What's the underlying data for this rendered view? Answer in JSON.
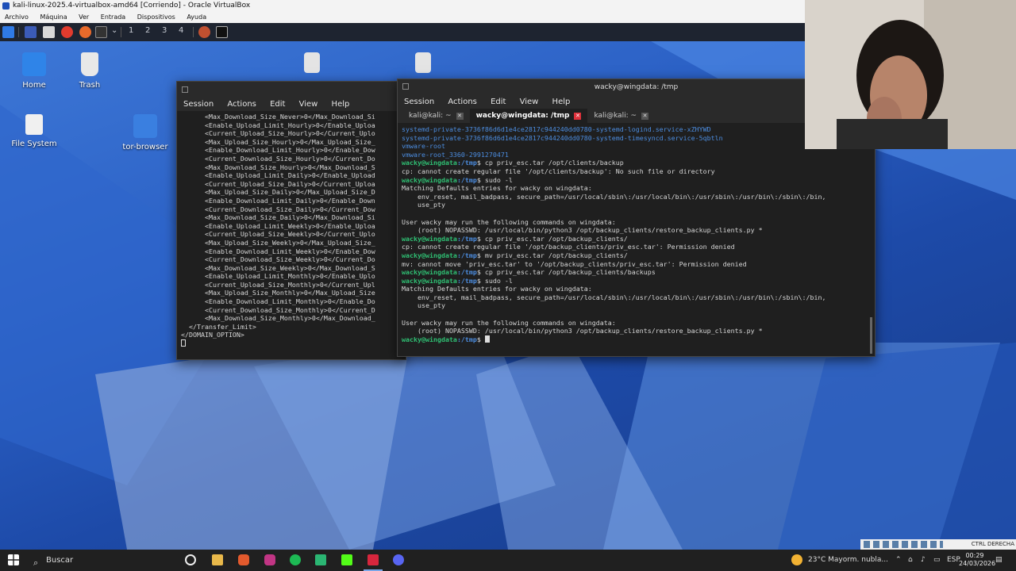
{
  "host": {
    "window_title": "kali-linux-2025.4-virtualbox-amd64 [Corriendo] - Oracle VirtualBox",
    "menu": [
      "Archivo",
      "Máquina",
      "Ver",
      "Entrada",
      "Dispositivos",
      "Ayuda"
    ]
  },
  "kali_panel": {
    "workspaces": [
      "1",
      "2",
      "3",
      "4"
    ]
  },
  "desktop_icons": [
    {
      "label": "Home"
    },
    {
      "label": "Trash"
    },
    {
      "label": "File System"
    },
    {
      "label": "tor-browser"
    }
  ],
  "term_left": {
    "menu": [
      "Session",
      "Actions",
      "Edit",
      "View",
      "Help"
    ],
    "lines": [
      "      <Max_Download_Size_Never>0</Max_Download_Si",
      "      <Enable_Upload_Limit_Hourly>0</Enable_Uploa",
      "      <Current_Upload_Size_Hourly>0</Current_Uplo",
      "      <Max_Upload_Size_Hourly>0</Max_Upload_Size_",
      "      <Enable_Download_Limit_Hourly>0</Enable_Dow",
      "      <Current_Download_Size_Hourly>0</Current_Do",
      "      <Max_Download_Size_Hourly>0</Max_Download_S",
      "      <Enable_Upload_Limit_Daily>0</Enable_Upload",
      "      <Current_Upload_Size_Daily>0</Current_Uploa",
      "      <Max_Upload_Size_Daily>0</Max_Upload_Size_D",
      "      <Enable_Download_Limit_Daily>0</Enable_Down",
      "      <Current_Download_Size_Daily>0</Current_Dow",
      "      <Max_Download_Size_Daily>0</Max_Download_Si",
      "      <Enable_Upload_Limit_Weekly>0</Enable_Uploa",
      "      <Current_Upload_Size_Weekly>0</Current_Uplo",
      "      <Max_Upload_Size_Weekly>0</Max_Upload_Size_",
      "      <Enable_Download_Limit_Weekly>0</Enable_Dow",
      "      <Current_Download_Size_Weekly>0</Current_Do",
      "      <Max_Download_Size_Weekly>0</Max_Download_S",
      "      <Enable_Upload_Limit_Monthly>0</Enable_Uplo",
      "      <Current_Upload_Size_Monthly>0</Current_Upl",
      "      <Max_Upload_Size_Monthly>0</Max_Upload_Size",
      "      <Enable_Download_Limit_Monthly>0</Enable_Do",
      "      <Current_Download_Size_Monthly>0</Current_D",
      "      <Max_Download_Size_Monthly>0</Max_Download_",
      "  </Transfer_Limit>",
      "</DOMAIN_OPTION>"
    ]
  },
  "term_right": {
    "title": "wacky@wingdata: /tmp",
    "menu": [
      "Session",
      "Actions",
      "Edit",
      "View",
      "Help"
    ],
    "tabs": [
      {
        "label": "kali@kali: ~",
        "active": false
      },
      {
        "label": "wacky@wingdata: /tmp",
        "active": true
      },
      {
        "label": "kali@kali: ~",
        "active": false
      }
    ],
    "prompt_user": "wacky@wingdata",
    "prompt_path": ":/tmp",
    "prompt_sym": "$",
    "lines": [
      {
        "t": "blue",
        "text": "systemd-private-3736f86d6d1e4ce2817c944240dd0780-systemd-logind.service-xZHYWD"
      },
      {
        "t": "blue",
        "text": "systemd-private-3736f86d6d1e4ce2817c944240dd0780-systemd-timesyncd.service-5qbtln"
      },
      {
        "t": "blue",
        "text": "vmware-root"
      },
      {
        "t": "blue",
        "text": "vmware-root_3360-2991270471"
      },
      {
        "t": "cmd",
        "text": " cp priv_esc.tar /opt/clients/backup"
      },
      {
        "t": "out",
        "text": "cp: cannot create regular file '/opt/clients/backup': No such file or directory"
      },
      {
        "t": "cmd",
        "text": " sudo -l"
      },
      {
        "t": "out",
        "text": "Matching Defaults entries for wacky on wingdata:"
      },
      {
        "t": "out",
        "text": "    env_reset, mail_badpass, secure_path=/usr/local/sbin\\:/usr/local/bin\\:/usr/sbin\\:/usr/bin\\:/sbin\\:/bin,"
      },
      {
        "t": "out",
        "text": "    use_pty"
      },
      {
        "t": "out",
        "text": ""
      },
      {
        "t": "out",
        "text": "User wacky may run the following commands on wingdata:"
      },
      {
        "t": "out",
        "text": "    (root) NOPASSWD: /usr/local/bin/python3 /opt/backup_clients/restore_backup_clients.py *"
      },
      {
        "t": "cmd",
        "text": " cp priv_esc.tar /opt/backup_clients/"
      },
      {
        "t": "out",
        "text": "cp: cannot create regular file '/opt/backup_clients/priv_esc.tar': Permission denied"
      },
      {
        "t": "cmd",
        "text": " mv priv_esc.tar /opt/backup_clients/"
      },
      {
        "t": "out",
        "text": "mv: cannot move 'priv_esc.tar' to '/opt/backup_clients/priv_esc.tar': Permission denied"
      },
      {
        "t": "cmd",
        "text": " cp priv_esc.tar /opt/backup_clients/backups"
      },
      {
        "t": "cmd",
        "text": " sudo -l"
      },
      {
        "t": "out",
        "text": "Matching Defaults entries for wacky on wingdata:"
      },
      {
        "t": "out",
        "text": "    env_reset, mail_badpass, secure_path=/usr/local/sbin\\:/usr/local/bin\\:/usr/sbin\\:/usr/bin\\:/sbin\\:/bin,"
      },
      {
        "t": "out",
        "text": "    use_pty"
      },
      {
        "t": "out",
        "text": ""
      },
      {
        "t": "out",
        "text": "User wacky may run the following commands on wingdata:"
      },
      {
        "t": "out",
        "text": "    (root) NOPASSWD: /usr/local/bin/python3 /opt/backup_clients/restore_backup_clients.py *"
      },
      {
        "t": "prompt",
        "text": " "
      }
    ]
  },
  "taskbar": {
    "search_placeholder": "Buscar",
    "weather": "23°C  Mayorm. nubla...",
    "lang": "ESP",
    "time": "00:29",
    "date": "24/03/2026",
    "vb_hostkey": "CTRL DERECHA"
  },
  "colors": {
    "prompt_green": "#2fbf73",
    "path_blue": "#4c8de0",
    "tab_close_red": "#e0313b"
  }
}
